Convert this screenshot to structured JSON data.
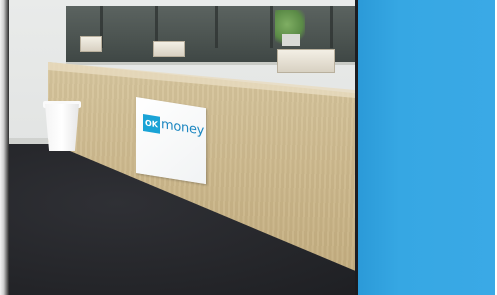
{
  "photo": {
    "sign": {
      "logo_text": "OK",
      "word_text": "money"
    },
    "colors": {
      "blue_panel": "#3aa9e6",
      "counter_wood": "#d7c69e",
      "carpet": "#25262a",
      "logo_blue": "#1aa3d6"
    }
  }
}
